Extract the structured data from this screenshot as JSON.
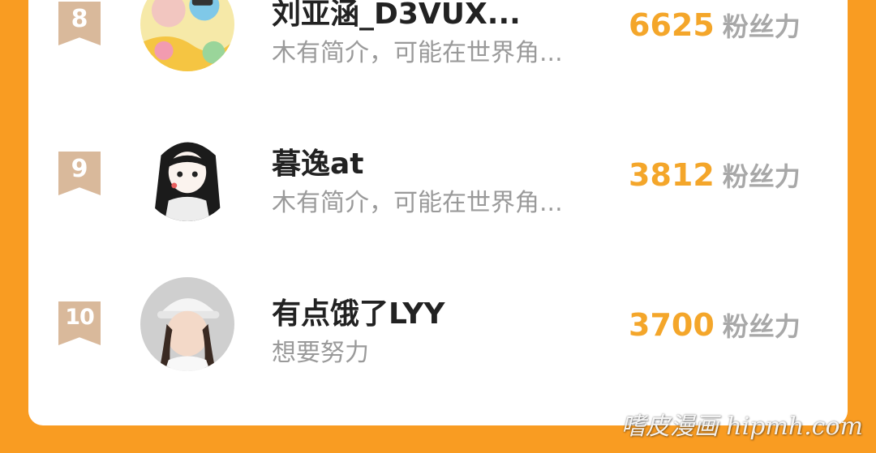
{
  "rankings": [
    {
      "rank": "8",
      "name": "刘亚涵_D3VUX...",
      "bio": "木有简介，可能在世界角...",
      "fans": "6625",
      "unit": "粉丝力"
    },
    {
      "rank": "9",
      "name": "暮逸at",
      "bio": "木有简介，可能在世界角...",
      "fans": "3812",
      "unit": "粉丝力"
    },
    {
      "rank": "10",
      "name": "有点饿了LYY",
      "bio": "想要努力",
      "fans": "3700",
      "unit": "粉丝力"
    }
  ],
  "watermark": "嗜皮漫画 hipmh.com",
  "colors": {
    "background": "#F99C22",
    "accent": "#F4A62A",
    "rank_badge": "#D9B99B"
  }
}
